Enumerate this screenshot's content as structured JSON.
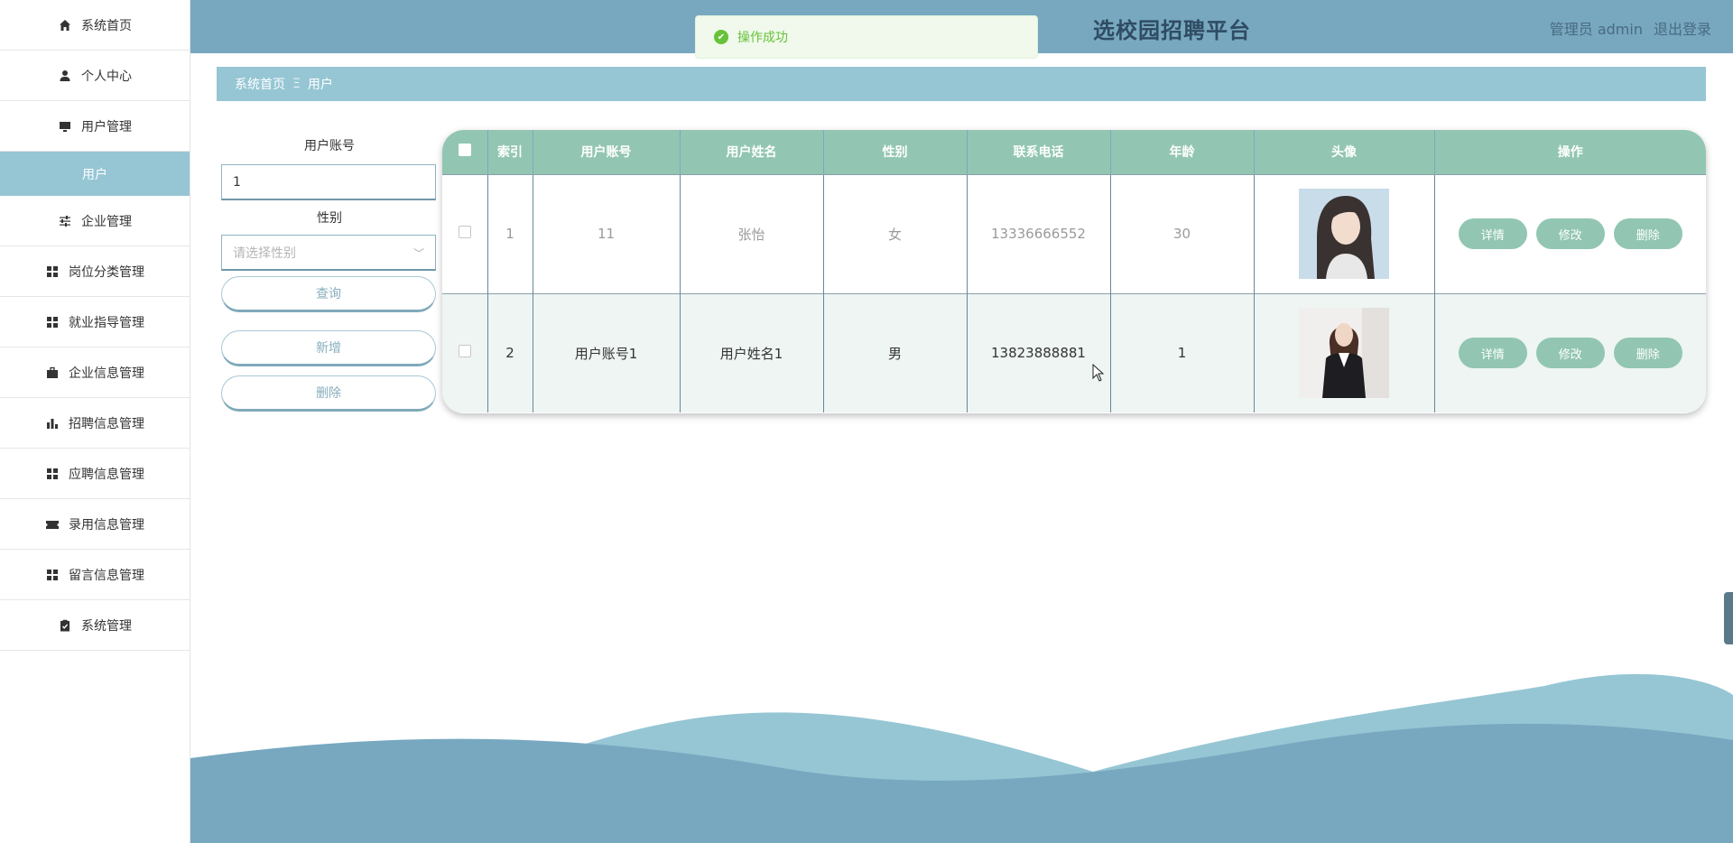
{
  "sidebar": {
    "items": [
      {
        "label": "系统首页",
        "icon": "home-icon"
      },
      {
        "label": "个人中心",
        "icon": "user-icon"
      },
      {
        "label": "用户管理",
        "icon": "monitor-icon"
      },
      {
        "label": "用户",
        "icon": ""
      },
      {
        "label": "企业管理",
        "icon": "sliders-icon"
      },
      {
        "label": "岗位分类管理",
        "icon": "grid-icon"
      },
      {
        "label": "就业指导管理",
        "icon": "grid-icon"
      },
      {
        "label": "企业信息管理",
        "icon": "briefcase-icon"
      },
      {
        "label": "招聘信息管理",
        "icon": "bar-chart-icon"
      },
      {
        "label": "应聘信息管理",
        "icon": "grid-icon"
      },
      {
        "label": "录用信息管理",
        "icon": "ticket-icon"
      },
      {
        "label": "留言信息管理",
        "icon": "grid-icon"
      },
      {
        "label": "系统管理",
        "icon": "clipboard-icon"
      }
    ]
  },
  "header": {
    "title": "选校园招聘平台",
    "user": "管理员 admin",
    "logout": "退出登录"
  },
  "toast": {
    "text": "操作成功",
    "icon": "check-circle-icon"
  },
  "breadcrumb": {
    "home": "系统首页",
    "separator": "Ξ",
    "current": "用户"
  },
  "search": {
    "account_label": "用户账号",
    "account_value": "1",
    "gender_label": "性别",
    "gender_placeholder": "请选择性别",
    "query_button": "查询",
    "add_button": "新增",
    "delete_button": "删除"
  },
  "table": {
    "headers": [
      "索引",
      "用户账号",
      "用户姓名",
      "性别",
      "联系电话",
      "年龄",
      "头像",
      "操作"
    ],
    "rows": [
      {
        "index": "1",
        "account": "11",
        "name": "张怡",
        "gender": "女",
        "phone": "13336666552",
        "age": "30"
      },
      {
        "index": "2",
        "account": "用户账号1",
        "name": "用户姓名1",
        "gender": "男",
        "phone": "13823888881",
        "age": "1"
      }
    ],
    "actions": {
      "detail": "详情",
      "edit": "修改",
      "delete": "删除"
    }
  },
  "colors": {
    "header_bg": "#77a8c0",
    "accent_light": "#96c6d4",
    "table_header": "#92c6b2",
    "toast_green": "#67c23a"
  }
}
